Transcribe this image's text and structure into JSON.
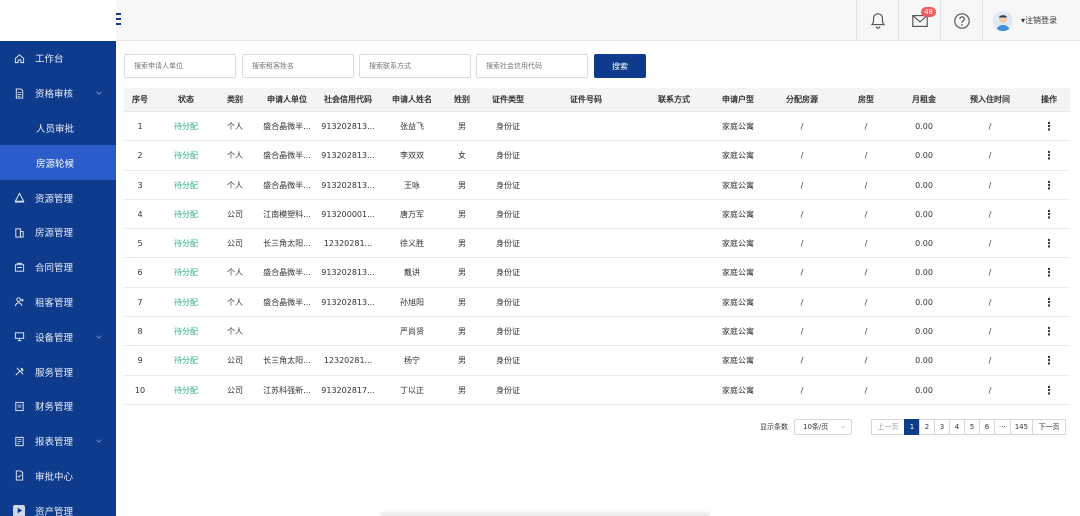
{
  "sidebar": {
    "items": [
      {
        "label": "工作台",
        "icon": "home-icon",
        "chevron": false
      },
      {
        "label": "资格审核",
        "icon": "document-icon",
        "chevron": true
      },
      {
        "label": "人员审批",
        "sub": true
      },
      {
        "label": "房源轮候",
        "sub": true,
        "active": true
      },
      {
        "label": "资源管理",
        "icon": "resource-icon",
        "chevron": false
      },
      {
        "label": "房源管理",
        "icon": "building-icon",
        "chevron": false
      },
      {
        "label": "合同管理",
        "icon": "contract-icon",
        "chevron": false
      },
      {
        "label": "租客管理",
        "icon": "tenant-icon",
        "chevron": false
      },
      {
        "label": "设备管理",
        "icon": "monitor-icon",
        "chevron": true
      },
      {
        "label": "服务管理",
        "icon": "tools-icon",
        "chevron": false
      },
      {
        "label": "财务管理",
        "icon": "finance-icon",
        "chevron": false
      },
      {
        "label": "报表管理",
        "icon": "report-icon",
        "chevron": true
      },
      {
        "label": "审批中心",
        "icon": "approval-icon",
        "chevron": false
      },
      {
        "label": "资产管理",
        "icon": "asset-icon",
        "chevron": false
      }
    ]
  },
  "topbar": {
    "message_badge": "48",
    "logout_label": "▾注销登录"
  },
  "search": {
    "placeholders": [
      "搜索申请人单位",
      "搜索租客姓名",
      "搜索联系方式",
      "搜索社会信用代码"
    ],
    "button_label": "搜索"
  },
  "table": {
    "headers": [
      "序号",
      "状态",
      "类别",
      "申请人单位",
      "社会信用代码",
      "申请人姓名",
      "姓别",
      "证件类型",
      "证件号码",
      "联系方式",
      "申请户型",
      "分配房源",
      "房型",
      "月租金",
      "预入住时间",
      "操作"
    ],
    "rows": [
      [
        "1",
        "待分配",
        "个人",
        "盛合晶微半...",
        "913202813...",
        "张益飞",
        "男",
        "身份证",
        "",
        "",
        "家庭公寓",
        "/",
        "/",
        "0.00",
        "/",
        "⋮"
      ],
      [
        "2",
        "待分配",
        "个人",
        "盛合晶微半...",
        "913202813...",
        "李双双",
        "女",
        "身份证",
        "",
        "",
        "家庭公寓",
        "/",
        "/",
        "0.00",
        "/",
        "⋮"
      ],
      [
        "3",
        "待分配",
        "个人",
        "盛合晶微半...",
        "913202813...",
        "王咏",
        "男",
        "身份证",
        "",
        "",
        "家庭公寓",
        "/",
        "/",
        "0.00",
        "/",
        "⋮"
      ],
      [
        "4",
        "待分配",
        "公司",
        "江南模塑科...",
        "913200001...",
        "唐万军",
        "男",
        "身份证",
        "",
        "",
        "家庭公寓",
        "/",
        "/",
        "0.00",
        "/",
        "⋮"
      ],
      [
        "5",
        "待分配",
        "公司",
        "长三角太阳...",
        "12320281...",
        "徐义胜",
        "男",
        "身份证",
        "",
        "",
        "家庭公寓",
        "/",
        "/",
        "0.00",
        "/",
        "⋮"
      ],
      [
        "6",
        "待分配",
        "个人",
        "盛合晶微半...",
        "913202813...",
        "戴讲",
        "男",
        "身份证",
        "",
        "",
        "家庭公寓",
        "/",
        "/",
        "0.00",
        "/",
        "⋮"
      ],
      [
        "7",
        "待分配",
        "个人",
        "盛合晶微半...",
        "913202813...",
        "孙旭阳",
        "男",
        "身份证",
        "",
        "",
        "家庭公寓",
        "/",
        "/",
        "0.00",
        "/",
        "⋮"
      ],
      [
        "8",
        "待分配",
        "个人",
        "",
        "",
        "严尚贤",
        "男",
        "身份证",
        "",
        "",
        "家庭公寓",
        "/",
        "/",
        "0.00",
        "/",
        "⋮"
      ],
      [
        "9",
        "待分配",
        "公司",
        "长三角太阳...",
        "12320281...",
        "杨宁",
        "男",
        "身份证",
        "",
        "",
        "家庭公寓",
        "/",
        "/",
        "0.00",
        "/",
        "⋮"
      ],
      [
        "10",
        "待分配",
        "公司",
        "江苏科强新...",
        "913202817...",
        "丁以正",
        "男",
        "身份证",
        "",
        "",
        "家庭公寓",
        "/",
        "/",
        "0.00",
        "/",
        "⋮"
      ]
    ]
  },
  "pagination": {
    "page_size_label": "显示条数",
    "page_size_value": "10条/页",
    "prev_label": "上一页",
    "next_label": "下一页",
    "pages": [
      "1",
      "2",
      "3",
      "4",
      "5",
      "6",
      "···",
      "145"
    ],
    "current": "1"
  },
  "colors": {
    "brand": "#0f3b8c",
    "active_nav": "#2b5cc9",
    "status_green": "#2bb28a",
    "badge_red": "#f25b5b"
  }
}
